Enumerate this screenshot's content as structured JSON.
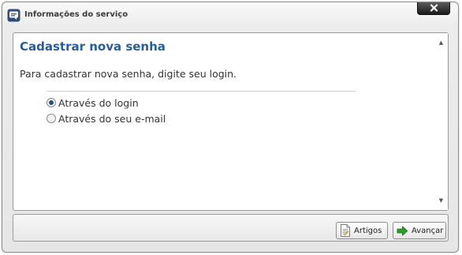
{
  "window": {
    "title": "Informações do serviço",
    "app_icon": "service-chat-icon",
    "close_icon": "close-icon"
  },
  "content": {
    "heading": "Cadastrar nova senha",
    "instructions": "Para cadastrar nova senha, digite seu login.",
    "options": [
      {
        "label": "Através do login",
        "selected": true
      },
      {
        "label": "Através do seu e-mail",
        "selected": false
      }
    ]
  },
  "scrollbar": {
    "up_glyph": "▲",
    "down_glyph": "▼"
  },
  "footer": {
    "artigos_label": "Artigos",
    "artigos_icon": "document-icon",
    "avancar_label": "Avançar",
    "avancar_icon": "arrow-right-icon"
  },
  "colors": {
    "heading": "#2a5d93",
    "next_arrow": "#2e9a2e",
    "close_button": "#1a1a1a"
  }
}
